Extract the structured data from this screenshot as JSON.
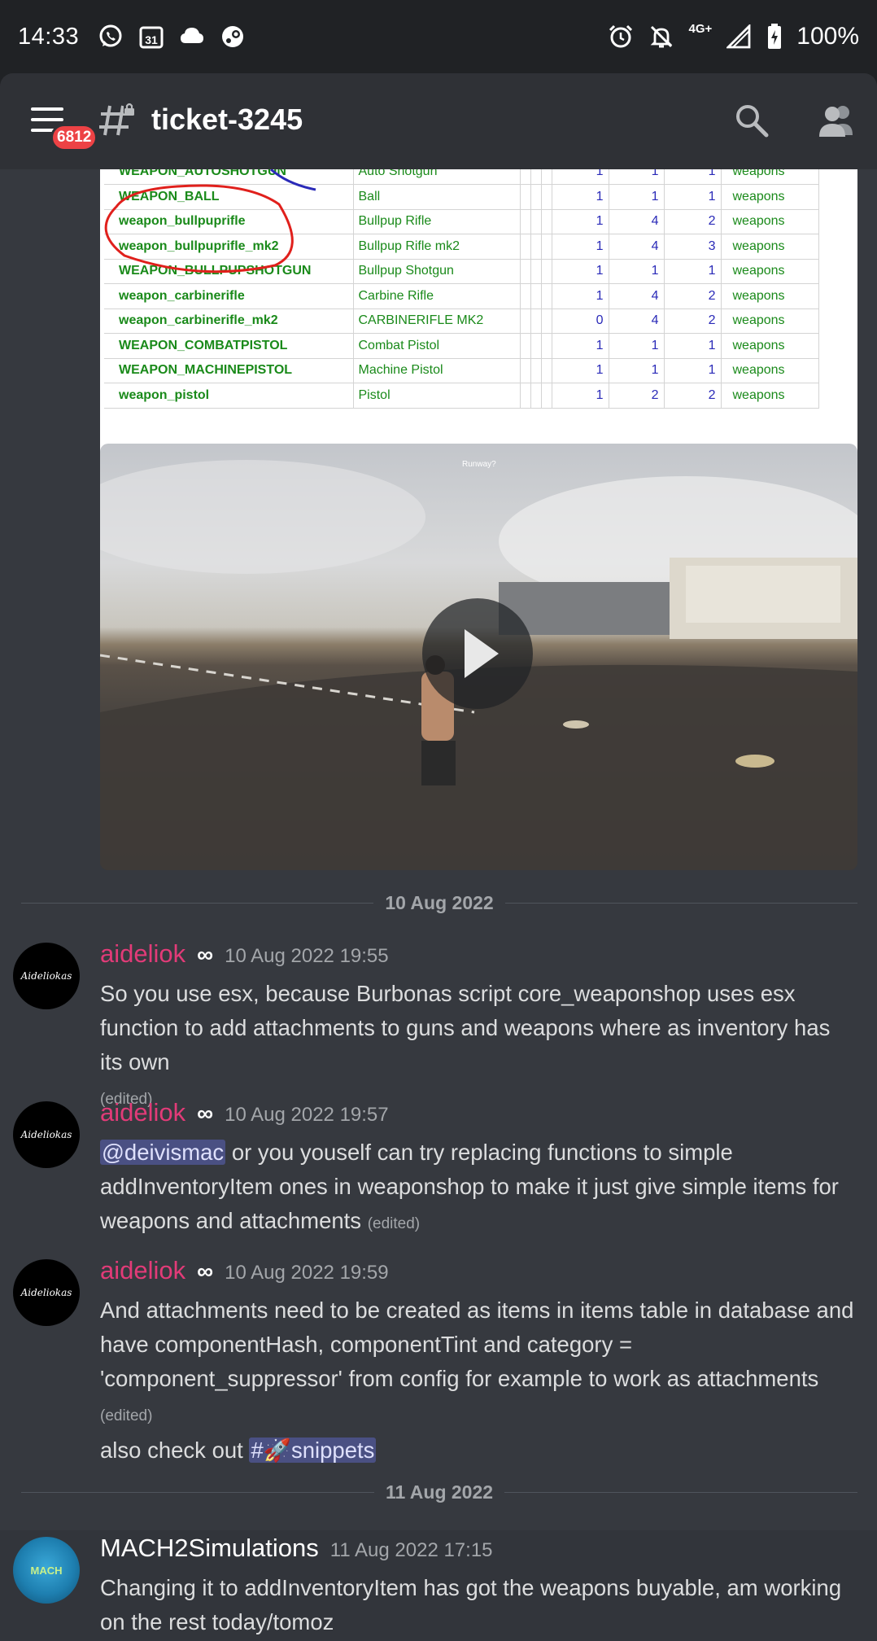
{
  "status_bar": {
    "time": "14:33",
    "left_icons": [
      "whatsapp-icon",
      "calendar-icon",
      "cloud-icon",
      "steam-icon"
    ],
    "calendar_day": "31",
    "network": "4G+",
    "battery": "100%"
  },
  "header": {
    "unread_badge": "6812",
    "channel_name": "ticket-3245"
  },
  "spreadsheet": {
    "rows": [
      {
        "name": "WEAPON_AUTOSHOTGUN",
        "label": "Auto Shotgun",
        "a": "1",
        "b": "1",
        "c": "1",
        "cat": "weapons"
      },
      {
        "name": "WEAPON_BALL",
        "label": "Ball",
        "a": "1",
        "b": "1",
        "c": "1",
        "cat": "weapons"
      },
      {
        "name": "weapon_bullpuprifle",
        "label": "Bullpup Rifle",
        "a": "1",
        "b": "4",
        "c": "2",
        "cat": "weapons"
      },
      {
        "name": "weapon_bullpuprifle_mk2",
        "label": "Bullpup Rifle mk2",
        "a": "1",
        "b": "4",
        "c": "3",
        "cat": "weapons"
      },
      {
        "name": "WEAPON_BULLPUPSHOTGUN",
        "label": "Bullpup Shotgun",
        "a": "1",
        "b": "1",
        "c": "1",
        "cat": "weapons"
      },
      {
        "name": "weapon_carbinerifle",
        "label": "Carbine Rifle",
        "a": "1",
        "b": "4",
        "c": "2",
        "cat": "weapons"
      },
      {
        "name": "weapon_carbinerifle_mk2",
        "label": "CARBINERIFLE MK2",
        "a": "0",
        "b": "4",
        "c": "2",
        "cat": "weapons"
      },
      {
        "name": "WEAPON_COMBATPISTOL",
        "label": "Combat Pistol",
        "a": "1",
        "b": "1",
        "c": "1",
        "cat": "weapons"
      },
      {
        "name": "WEAPON_MACHINEPISTOL",
        "label": "Machine Pistol",
        "a": "1",
        "b": "1",
        "c": "1",
        "cat": "weapons"
      },
      {
        "name": "weapon_pistol",
        "label": "Pistol",
        "a": "1",
        "b": "2",
        "c": "2",
        "cat": "weapons"
      }
    ]
  },
  "video": {
    "hud_location": "Runway?"
  },
  "dividers": {
    "first": "10 Aug 2022",
    "second": "11 Aug 2022"
  },
  "messages": [
    {
      "author": "aideliok",
      "badge": "∞",
      "timestamp": "10 Aug 2022 19:55",
      "text": "So you use esx, because Burbonas script core_weaponshop uses esx function to add attachments to guns and weapons where as inventory has its own",
      "edited": "(edited)",
      "avatar_text": "Aideliokas"
    },
    {
      "author": "aideliok",
      "badge": "∞",
      "timestamp": "10 Aug 2022 19:57",
      "mention": "@deivismac",
      "text": " or you youself can try replacing functions to simple addInventoryItem ones in weaponshop to make it just give simple items for weapons and attachments ",
      "edited": "(edited)",
      "avatar_text": "Aideliokas"
    },
    {
      "author": "aideliok",
      "badge": "∞",
      "timestamp": "10 Aug 2022 19:59",
      "text": "And attachments need to be created as items in items table in database and have componentHash, componentTint and category = 'component_suppressor' from config for example to work as attachments",
      "edited": "(edited)",
      "followup_text": "also check out ",
      "channel_link": "#🚀snippets",
      "avatar_text": "Aideliokas"
    },
    {
      "author": "MACH2Simulations",
      "timestamp": "11 Aug 2022 17:15",
      "text": "Changing it to addInventoryItem has got the weapons buyable, am working on the rest today/tomoz",
      "avatar_text": "MACH"
    }
  ]
}
